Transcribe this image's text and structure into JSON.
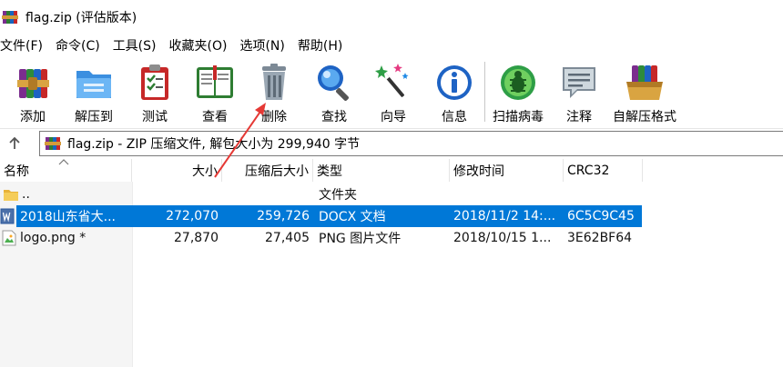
{
  "window": {
    "title": "flag.zip (评估版本)"
  },
  "menu": [
    "文件(F)",
    "命令(C)",
    "工具(S)",
    "收藏夹(O)",
    "选项(N)",
    "帮助(H)"
  ],
  "toolbar": {
    "buttons": [
      {
        "label": "添加",
        "icon": "add-books-icon"
      },
      {
        "label": "解压到",
        "icon": "extract-folder-icon"
      },
      {
        "label": "测试",
        "icon": "test-clipboard-icon"
      },
      {
        "label": "查看",
        "icon": "view-book-icon"
      },
      {
        "label": "删除",
        "icon": "trash-icon"
      },
      {
        "label": "查找",
        "icon": "magnifier-icon"
      },
      {
        "label": "向导",
        "icon": "wizard-wand-icon"
      },
      {
        "label": "信息",
        "icon": "info-icon"
      },
      {
        "label": "扫描病毒",
        "icon": "virus-scan-icon"
      },
      {
        "label": "注释",
        "icon": "comment-icon"
      },
      {
        "label": "自解压格式",
        "icon": "sfx-box-icon"
      }
    ]
  },
  "address": {
    "text": "flag.zip - ZIP 压缩文件, 解包大小为 299,940 字节"
  },
  "columns": [
    "名称",
    "大小",
    "压缩后大小",
    "类型",
    "修改时间",
    "CRC32"
  ],
  "rows": [
    {
      "name": "..",
      "size": "",
      "packed": "",
      "type": "文件夹",
      "modified": "",
      "crc": "",
      "icon": "folder-icon",
      "selected": false
    },
    {
      "name": "2018山东省大...",
      "size": "272,070",
      "packed": "259,726",
      "type": "DOCX 文档",
      "modified": "2018/11/2 14:...",
      "crc": "6C5C9C45",
      "icon": "word-doc-icon",
      "selected": true
    },
    {
      "name": "logo.png *",
      "size": "27,870",
      "packed": "27,405",
      "type": "PNG 图片文件",
      "modified": "2018/10/15 1...",
      "crc": "3E62BF64",
      "icon": "image-file-icon",
      "selected": false
    }
  ],
  "colors": {
    "selection": "#0078d7",
    "annotation_arrow": "#e53935"
  }
}
